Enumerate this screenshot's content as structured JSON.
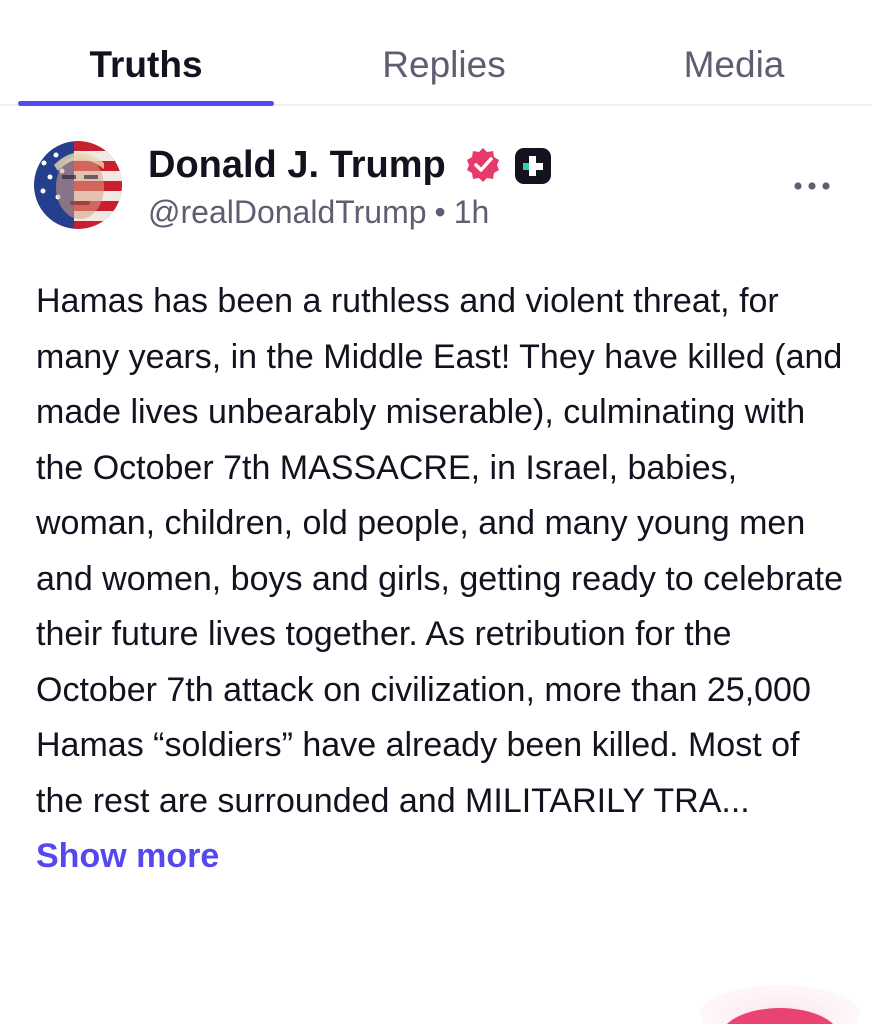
{
  "tabs": [
    {
      "label": "Truths",
      "active": true
    },
    {
      "label": "Replies",
      "active": false
    },
    {
      "label": "Media",
      "active": false
    }
  ],
  "colors": {
    "accent": "#5448ee",
    "verified": "#e83a6a",
    "text": "#14121f",
    "muted": "#5e5d72"
  },
  "post": {
    "author_name": "Donald J. Trump",
    "handle": "@realDonaldTrump",
    "separator": "•",
    "time": "1h",
    "icons": [
      "verified-badge-icon",
      "truth-plus-icon",
      "more-options-icon"
    ],
    "body": "Hamas has been a ruthless and violent threat, for many years, in the Middle East! They have killed (and made lives unbearably miserable), culminating with the October 7th MASSACRE, in Israel, babies, woman, children, old people, and many young men and women, boys and girls, getting ready to celebrate their future lives together. As retribution for the October 7th attack on civilization, more than 25,000 Hamas “soldiers” have already been killed. Most of the rest are surrounded and MILITARILY TRA...",
    "show_more_label": "Show more"
  }
}
